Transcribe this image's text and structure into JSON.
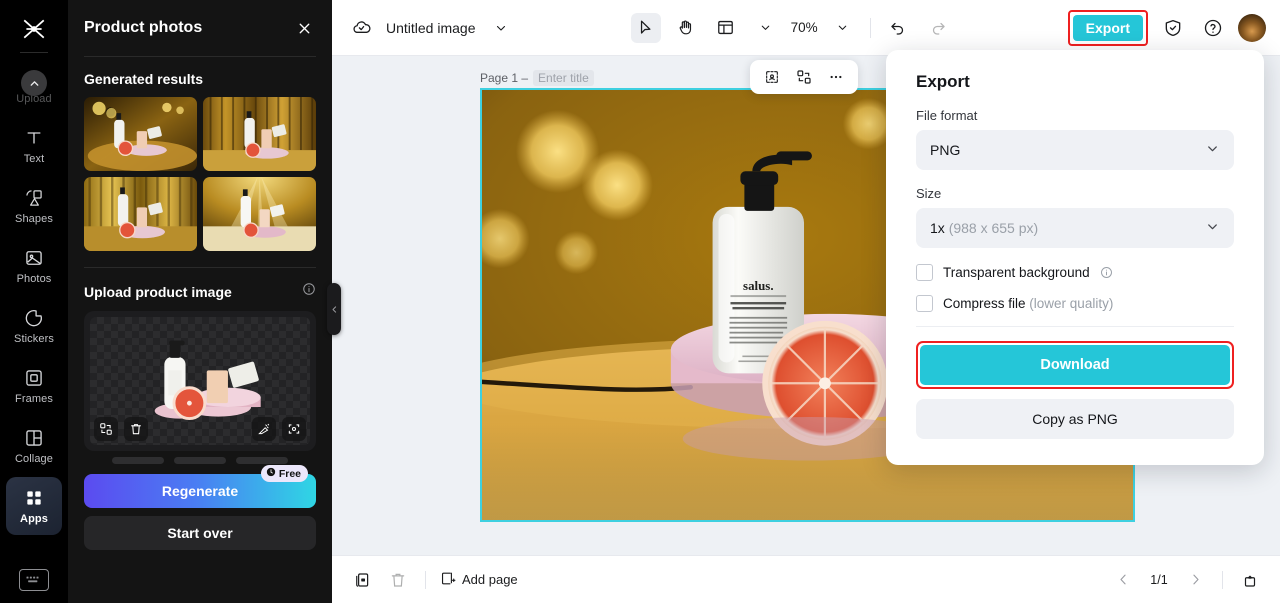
{
  "rail": {
    "logo_icon": "capcut-logo-icon",
    "items": [
      {
        "label": "Upload",
        "icon": "upload-icon",
        "active": false,
        "dim": true
      },
      {
        "label": "Text",
        "icon": "text-icon",
        "active": false,
        "dim": false
      },
      {
        "label": "Shapes",
        "icon": "shapes-icon",
        "active": false,
        "dim": false
      },
      {
        "label": "Photos",
        "icon": "photos-icon",
        "active": false,
        "dim": false
      },
      {
        "label": "Stickers",
        "icon": "stickers-icon",
        "active": false,
        "dim": false
      },
      {
        "label": "Frames",
        "icon": "frames-icon",
        "active": false,
        "dim": false
      },
      {
        "label": "Collage",
        "icon": "collage-icon",
        "active": false,
        "dim": false
      },
      {
        "label": "Apps",
        "icon": "apps-grid-icon",
        "active": true,
        "dim": false
      }
    ],
    "bottom_icon": "keyboard-shortcuts-icon"
  },
  "panel": {
    "title": "Product photos",
    "close_icon": "close-icon",
    "generated_section_title": "Generated results",
    "results": [
      {
        "name": "generated-result-1"
      },
      {
        "name": "generated-result-2"
      },
      {
        "name": "generated-result-3"
      },
      {
        "name": "generated-result-4"
      }
    ],
    "upload_section_title": "Upload product image",
    "upload_info_icon": "info-icon",
    "dropzone_buttons": [
      {
        "name": "replace-image-icon"
      },
      {
        "name": "delete-image-icon"
      },
      {
        "name": "edit-magic-icon"
      },
      {
        "name": "crop-expand-icon"
      }
    ],
    "regenerate_label": "Regenerate",
    "free_badge_label": "Free",
    "free_badge_icon": "clock-icon",
    "start_over_label": "Start over",
    "collapse_icon": "chevron-left-icon"
  },
  "topbar": {
    "cloud_icon": "cloud-saved-icon",
    "doc_title": "Untitled image",
    "doc_title_caret": "chevron-down-icon",
    "tools": [
      {
        "name": "select-tool",
        "icon": "cursor-icon",
        "selected": true
      },
      {
        "name": "hand-tool",
        "icon": "hand-icon",
        "selected": false
      },
      {
        "name": "layout-tool",
        "icon": "layout-panel-icon",
        "selected": false
      }
    ],
    "zoom_level": "70%",
    "zoom_caret": "chevron-down-icon",
    "undo_icon": "undo-icon",
    "redo_icon": "redo-icon",
    "export_label": "Export",
    "shield_icon": "shield-check-icon",
    "help_icon": "help-circle-icon",
    "avatar": "user-avatar"
  },
  "canvas": {
    "page_label": "Page 1 –",
    "title_placeholder": "Enter title",
    "float_tools": [
      {
        "name": "select-subject-icon"
      },
      {
        "name": "remove-background-icon"
      },
      {
        "name": "more-options-icon"
      }
    ]
  },
  "bottombar": {
    "duplicate_page_icon": "duplicate-page-icon",
    "delete_page_icon": "delete-page-icon",
    "add_page_label": "Add page",
    "add_page_icon": "add-page-icon",
    "prev_icon": "chevron-left-icon",
    "page_indicator": "1/1",
    "next_icon": "chevron-right-icon",
    "grid_view_icon": "page-grid-icon"
  },
  "export_panel": {
    "title": "Export",
    "file_format_label": "File format",
    "file_format_value": "PNG",
    "size_label": "Size",
    "size_value": "1x",
    "size_value_detail": "(988 x 655 px)",
    "transparent_label": "Transparent background",
    "transparent_checked": false,
    "compress_label": "Compress file",
    "compress_label_muted": "(lower quality)",
    "compress_checked": false,
    "download_label": "Download",
    "copy_label": "Copy as PNG",
    "caret_icon": "chevron-down-icon",
    "info_icon": "info-icon"
  },
  "colors": {
    "accent_cyan": "#25c6d8",
    "highlight_red": "#ef2020",
    "selection_cyan": "#3ed0e0",
    "panel_bg": "#141414",
    "rail_bg": "#000000"
  }
}
